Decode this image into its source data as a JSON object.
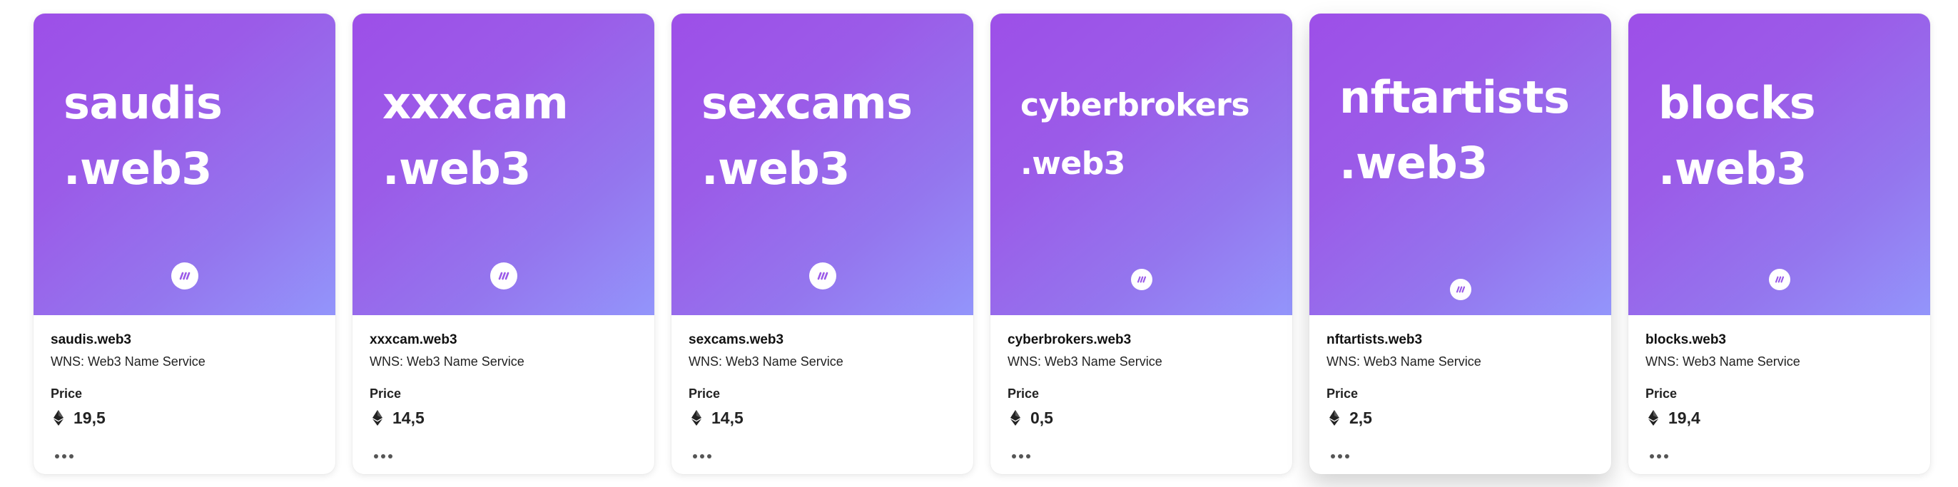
{
  "cards": [
    {
      "line1": "saudis",
      "line2": ".web3",
      "title": "saudis.web3",
      "collection": "WNS: Web3 Name Service",
      "price_label": "Price",
      "price": "19,5"
    },
    {
      "line1": "xxxcam",
      "line2": ".web3",
      "title": "xxxcam.web3",
      "collection": "WNS: Web3 Name Service",
      "price_label": "Price",
      "price": "14,5"
    },
    {
      "line1": "sexcams",
      "line2": ".web3",
      "title": "sexcams.web3",
      "collection": "WNS: Web3 Name Service",
      "price_label": "Price",
      "price": "14,5"
    },
    {
      "line1": "cyberbrokers",
      "line2": ".web3",
      "title": "cyberbrokers.web3",
      "collection": "WNS: Web3 Name Service",
      "price_label": "Price",
      "price": "0,5"
    },
    {
      "line1": "nftartists",
      "line2": ".web3",
      "title": "nftartists.web3",
      "collection": "WNS: Web3 Name Service",
      "price_label": "Price",
      "price": "2,5"
    },
    {
      "line1": "blocks",
      "line2": ".web3",
      "title": "blocks.web3",
      "collection": "WNS: Web3 Name Service",
      "price_label": "Price",
      "price": "19,4"
    }
  ],
  "icons": {
    "logo": "wns-logo-icon",
    "currency": "ethereum-icon",
    "more": "more-options-icon"
  },
  "colors": {
    "gradient_start": "#9d4fe8",
    "gradient_end": "#9395fb"
  }
}
